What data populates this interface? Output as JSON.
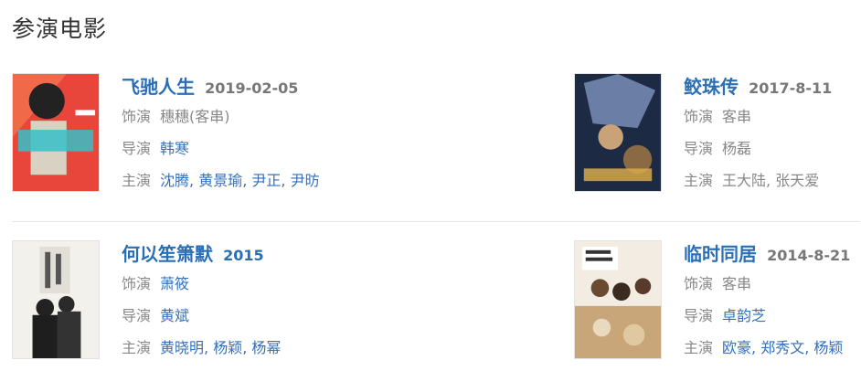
{
  "section": {
    "title": "参演电影"
  },
  "labels": {
    "role": "饰演",
    "director": "导演",
    "cast": "主演"
  },
  "movies": [
    {
      "title": "飞驰人生",
      "date": "2019-02-05",
      "role": "穗穗(客串)",
      "director": "韩寒",
      "cast": [
        "沈腾",
        "黄景瑜",
        "尹正",
        "尹昉"
      ],
      "poster_icon": "movie-poster"
    },
    {
      "title": "鲛珠传",
      "date": "2017-8-11",
      "role": "客串",
      "director": "杨磊",
      "cast": [
        "王大陆",
        "张天爱"
      ],
      "poster_icon": "movie-poster"
    },
    {
      "title": "何以笙箫默",
      "date": "2015",
      "role": "萧筱",
      "director": "黄斌",
      "cast": [
        "黄晓明",
        "杨颖",
        "杨幂"
      ],
      "poster_icon": "movie-poster"
    },
    {
      "title": "临时同居",
      "date": "2014-8-21",
      "role": "客串",
      "director": "卓韵芝",
      "cast": [
        "欧豪",
        "郑秀文",
        "杨颖"
      ],
      "poster_icon": "movie-poster"
    }
  ],
  "colors": {
    "link": "#3670b8",
    "title": "#2a6fb6",
    "muted": "#888888",
    "date": "#777777"
  }
}
